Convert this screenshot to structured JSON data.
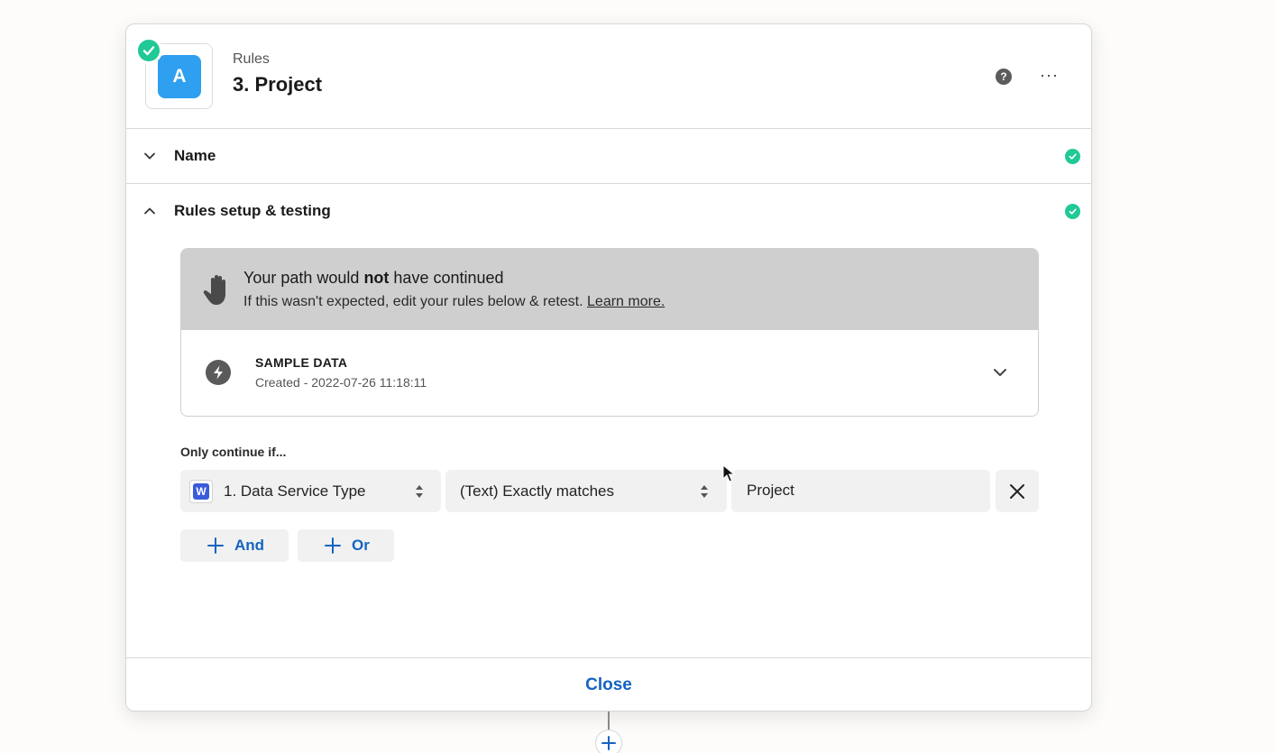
{
  "header": {
    "app_icon_letter": "A",
    "subtitle": "Rules",
    "title": "3. Project",
    "help_icon": "?",
    "more_icon": "···"
  },
  "sections": {
    "name_label": "Name",
    "rules_label": "Rules setup & testing"
  },
  "result": {
    "title_before": "Your path would ",
    "title_bold": "not",
    "title_after": " have continued",
    "subtitle": "If this wasn't expected, edit your rules below & retest. ",
    "link": "Learn more."
  },
  "sample": {
    "title": "SAMPLE DATA",
    "created": "Created - 2022-07-26 11:18:11"
  },
  "filter": {
    "label": "Only continue if...",
    "field_badge": "W",
    "field": "1. Data Service Type",
    "condition": "(Text) Exactly matches",
    "value": "Project"
  },
  "buttons": {
    "and": "And",
    "or": "Or",
    "close": "Close"
  },
  "colors": {
    "accent": "#1564c0",
    "success": "#20c997",
    "app_icon": "#2f9fef",
    "banner": "#cfcfcf"
  }
}
